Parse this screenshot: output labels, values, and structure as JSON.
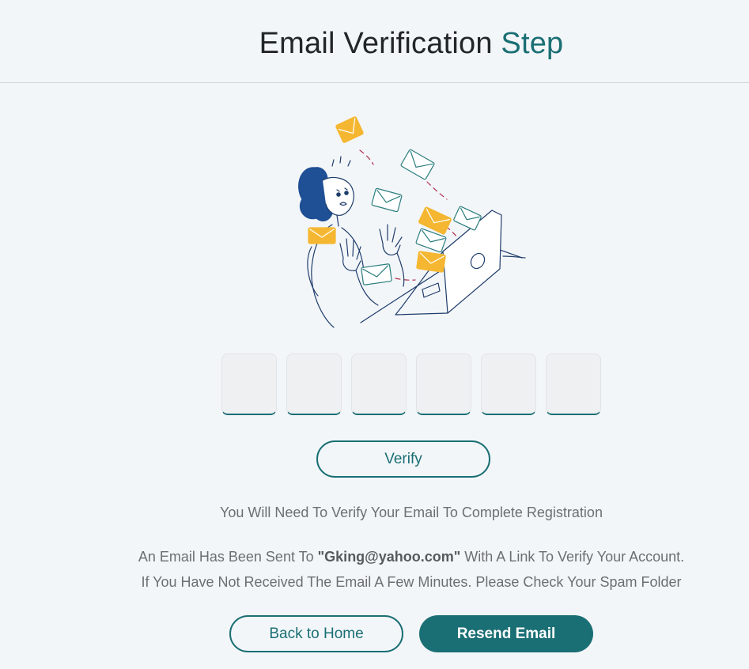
{
  "header": {
    "title_main": "Email Verification",
    "title_accent": "Step"
  },
  "colors": {
    "accent": "#1a6f74",
    "envelope_yellow": "#f5b731",
    "hair_blue": "#1f4f94",
    "background": "#f3f6f9"
  },
  "illustration": {
    "icon": "overwhelmed-person-emails-illustration"
  },
  "otp": {
    "digits": [
      "",
      "",
      "",
      "",
      "",
      ""
    ]
  },
  "verify": {
    "label": "Verify"
  },
  "messages": {
    "line1": "You Will Need To Verify Your Email To Complete Registration",
    "line2_before": "An Email Has Been Sent To ",
    "email": "\"Gking@yahoo.com\"",
    "line2_after": " With A Link To Verify Your Account.",
    "line3": "If You Have Not Received The Email A Few Minutes. Please Check Your Spam Folder"
  },
  "actions": {
    "back_label": "Back to Home",
    "resend_label": "Resend Email"
  }
}
